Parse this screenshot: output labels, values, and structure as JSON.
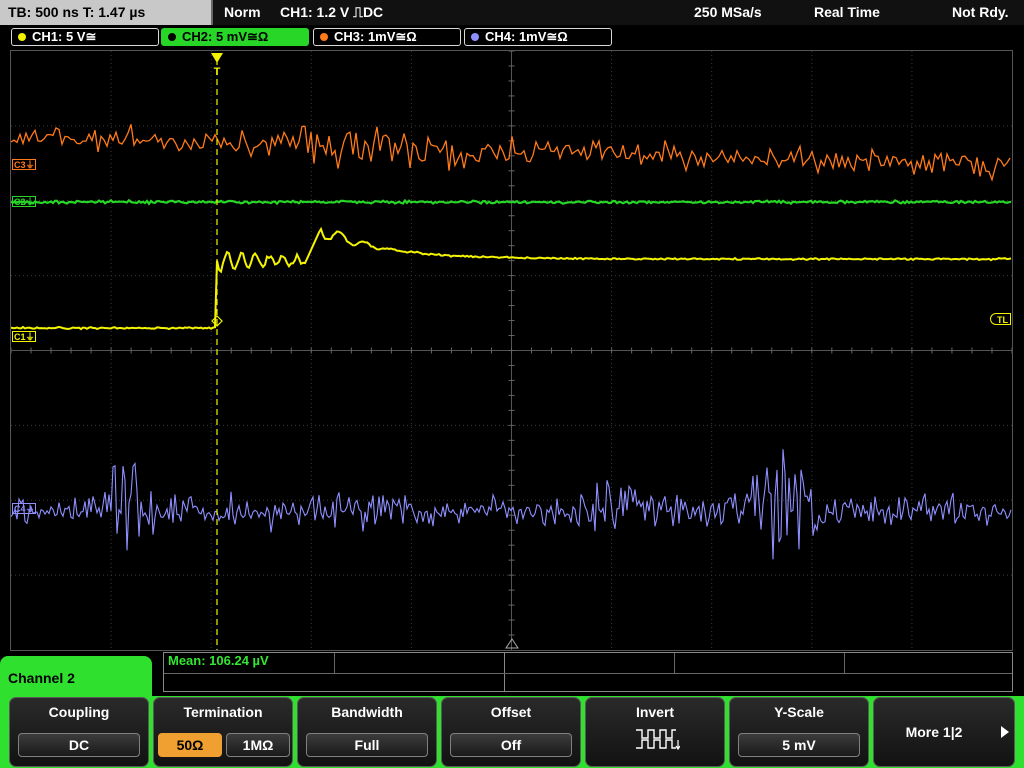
{
  "status": {
    "timebase": "TB: 500 ns  T: 1.47 µs",
    "mode": "Norm",
    "trigger": "CH1: 1.2 V ⎍DC",
    "sample_rate": "250 MSa/s",
    "acquisition": "Real Time",
    "ready_state": "Not Rdy."
  },
  "channels": [
    {
      "label": "CH1: 5 V≅",
      "color": "#f4f400"
    },
    {
      "label": "CH2: 5 mV≅Ω",
      "color": "#27d627"
    },
    {
      "label": "CH3: 1mV≅Ω",
      "color": "#ff7a1a"
    },
    {
      "label": "CH4: 1mV≅Ω",
      "color": "#8f8fff"
    }
  ],
  "markers": {
    "c3": "C3",
    "c2": "C2",
    "c1": "C1",
    "c4": "C4",
    "trigger_level": "TL",
    "trigger_pos": "T"
  },
  "measurement": {
    "text": "Mean: 106.24 µV"
  },
  "menu": {
    "channel_label": "Channel 2"
  },
  "softkeys": {
    "coupling": {
      "title": "Coupling",
      "value": "DC"
    },
    "termination": {
      "title": "Termination",
      "options": [
        "50Ω",
        "1MΩ"
      ],
      "selected": "50Ω"
    },
    "bandwidth": {
      "title": "Bandwidth",
      "value": "Full"
    },
    "offset": {
      "title": "Offset",
      "value": "Off"
    },
    "invert": {
      "title": "Invert",
      "icon": "invert-waveform-icon"
    },
    "yscale": {
      "title": "Y-Scale",
      "value": "5 mV"
    },
    "more": {
      "label": "More 1|2"
    }
  },
  "colors": {
    "ch1": "#f4f400",
    "ch2": "#27d627",
    "ch3": "#ff7a1a",
    "ch4": "#8f8fff",
    "menu_active": "#2fe02f",
    "termination_selected": "#f0a030"
  }
}
